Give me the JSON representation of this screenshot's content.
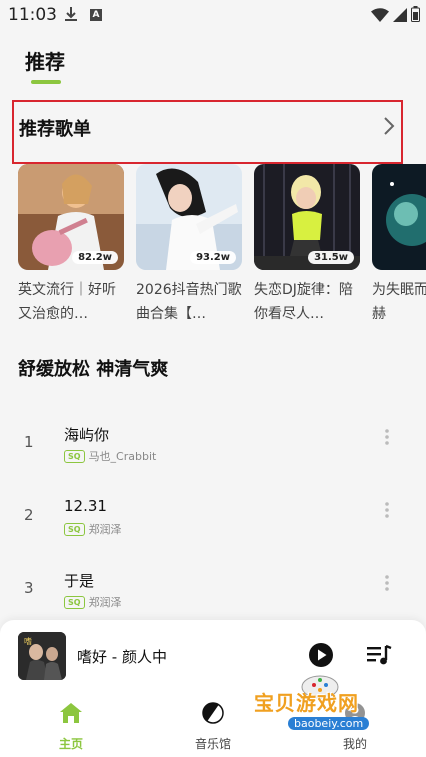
{
  "status_bar": {
    "time": "11:03",
    "notif_letter": "A"
  },
  "top_tab": {
    "label": "推荐"
  },
  "recommended": {
    "title": "推荐歌单",
    "cards": [
      {
        "title": "英文流行｜好听又治愈的…",
        "count": "82.2w"
      },
      {
        "title": "2026抖音热门歌曲合集【…",
        "count": "93.2w"
      },
      {
        "title": "失恋DJ旋律：陪你看尽人…",
        "count": "31.5w"
      },
      {
        "title": "为失眠而收集因赫",
        "count": ""
      }
    ]
  },
  "songs": {
    "section_title": "舒缓放松 神清气爽",
    "quality_badge": "SQ",
    "items": [
      {
        "index": "1",
        "name": "海屿你",
        "artist": "马也_Crabbit"
      },
      {
        "index": "2",
        "name": "12.31",
        "artist": "郑润泽"
      },
      {
        "index": "3",
        "name": "于是",
        "artist": "郑润泽"
      }
    ]
  },
  "player": {
    "title": "嗜好 - 颜人中"
  },
  "nav": {
    "items": [
      {
        "label": "主页"
      },
      {
        "label": "音乐馆"
      },
      {
        "label": "我的"
      }
    ]
  },
  "watermark": {
    "text": "宝贝游戏网",
    "sub": "baobeiy.com"
  },
  "colors": {
    "accent": "#8cc63f",
    "highlight_border": "#d8262f"
  }
}
